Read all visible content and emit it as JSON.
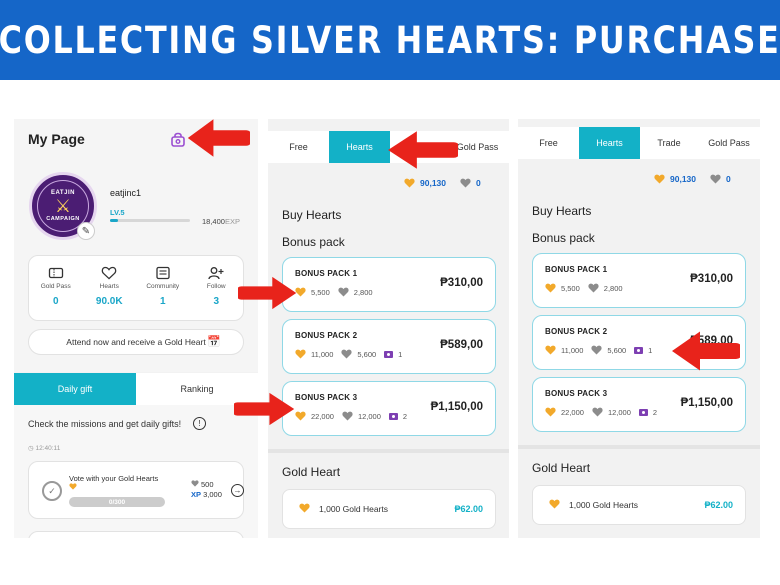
{
  "banner": {
    "title": "COLLECTING SILVER HEARTS: PURCHASE"
  },
  "colors": {
    "banner": "#1566c8",
    "accent": "#13b1c7",
    "arrow": "#e8231b",
    "gold_heart": "#f2a92b",
    "silver_heart": "#8c8c8c",
    "ticket": "#7d3fb2",
    "avatar": "#4b1d73"
  },
  "my_page": {
    "title": "My Page",
    "settings_icon": "shop-settings-icon",
    "avatar": {
      "top_text": "EATJIN",
      "bottom_text": "CAMPAIGN"
    },
    "username": "eatjinc1",
    "level": "LV.5",
    "xp_value": "18,400",
    "xp_unit": "EXP",
    "xp_progress": 0.1,
    "stats": [
      {
        "label": "Gold Pass",
        "value": "0",
        "icon": "ticket-icon"
      },
      {
        "label": "Hearts",
        "value": "90.0K",
        "icon": "heart-icon"
      },
      {
        "label": "Community",
        "value": "1",
        "icon": "community-icon"
      },
      {
        "label": "Follow",
        "value": "3",
        "icon": "follow-icon"
      }
    ],
    "attend_text": "Attend now and receive a Gold Heart",
    "tabs": [
      "Daily gift",
      "Ranking"
    ],
    "missions_text": "Check the missions and get daily gifts!",
    "timer": "12:40:11",
    "mission": {
      "title_line1": "Vote with your Gold Hearts",
      "progress": "0/300",
      "reward_silver": "500",
      "reward_xp_label": "XP",
      "reward_xp": "3,000"
    }
  },
  "shop_mid": {
    "tabs": [
      "Free",
      "Hearts",
      "",
      "Gold Pass"
    ],
    "active_tab": 1,
    "balance_gold": "90,130",
    "balance_silver": "0",
    "buy_heading": "Buy Hearts",
    "bonus_heading": "Bonus pack",
    "packs": [
      {
        "name": "BONUS PACK 1",
        "gold": "5,500",
        "silver": "2,800",
        "ticket": "",
        "price": "₱310,00"
      },
      {
        "name": "BONUS PACK 2",
        "gold": "11,000",
        "silver": "5,600",
        "ticket": "1",
        "price": "₱589,00"
      },
      {
        "name": "BONUS PACK 3",
        "gold": "22,000",
        "silver": "12,000",
        "ticket": "2",
        "price": "₱1,150,00"
      }
    ],
    "gold_heading": "Gold Heart",
    "gold_item": {
      "label": "1,000 Gold Hearts",
      "price": "₱62.00"
    }
  },
  "shop_right": {
    "tabs": [
      "Free",
      "Hearts",
      "Trade",
      "Gold Pass"
    ],
    "active_tab": 1,
    "balance_gold": "90,130",
    "balance_silver": "0",
    "buy_heading": "Buy Hearts",
    "bonus_heading": "Bonus pack",
    "packs": [
      {
        "name": "BONUS PACK 1",
        "gold": "5,500",
        "silver": "2,800",
        "ticket": "",
        "price": "₱310,00"
      },
      {
        "name": "BONUS PACK 2",
        "gold": "11,000",
        "silver": "5,600",
        "ticket": "1",
        "price": "₱589,00"
      },
      {
        "name": "BONUS PACK 3",
        "gold": "22,000",
        "silver": "12,000",
        "ticket": "2",
        "price": "₱1,150,00"
      }
    ],
    "gold_heading": "Gold Heart",
    "gold_item": {
      "label": "1,000 Gold Hearts",
      "price": "₱62.00"
    }
  }
}
